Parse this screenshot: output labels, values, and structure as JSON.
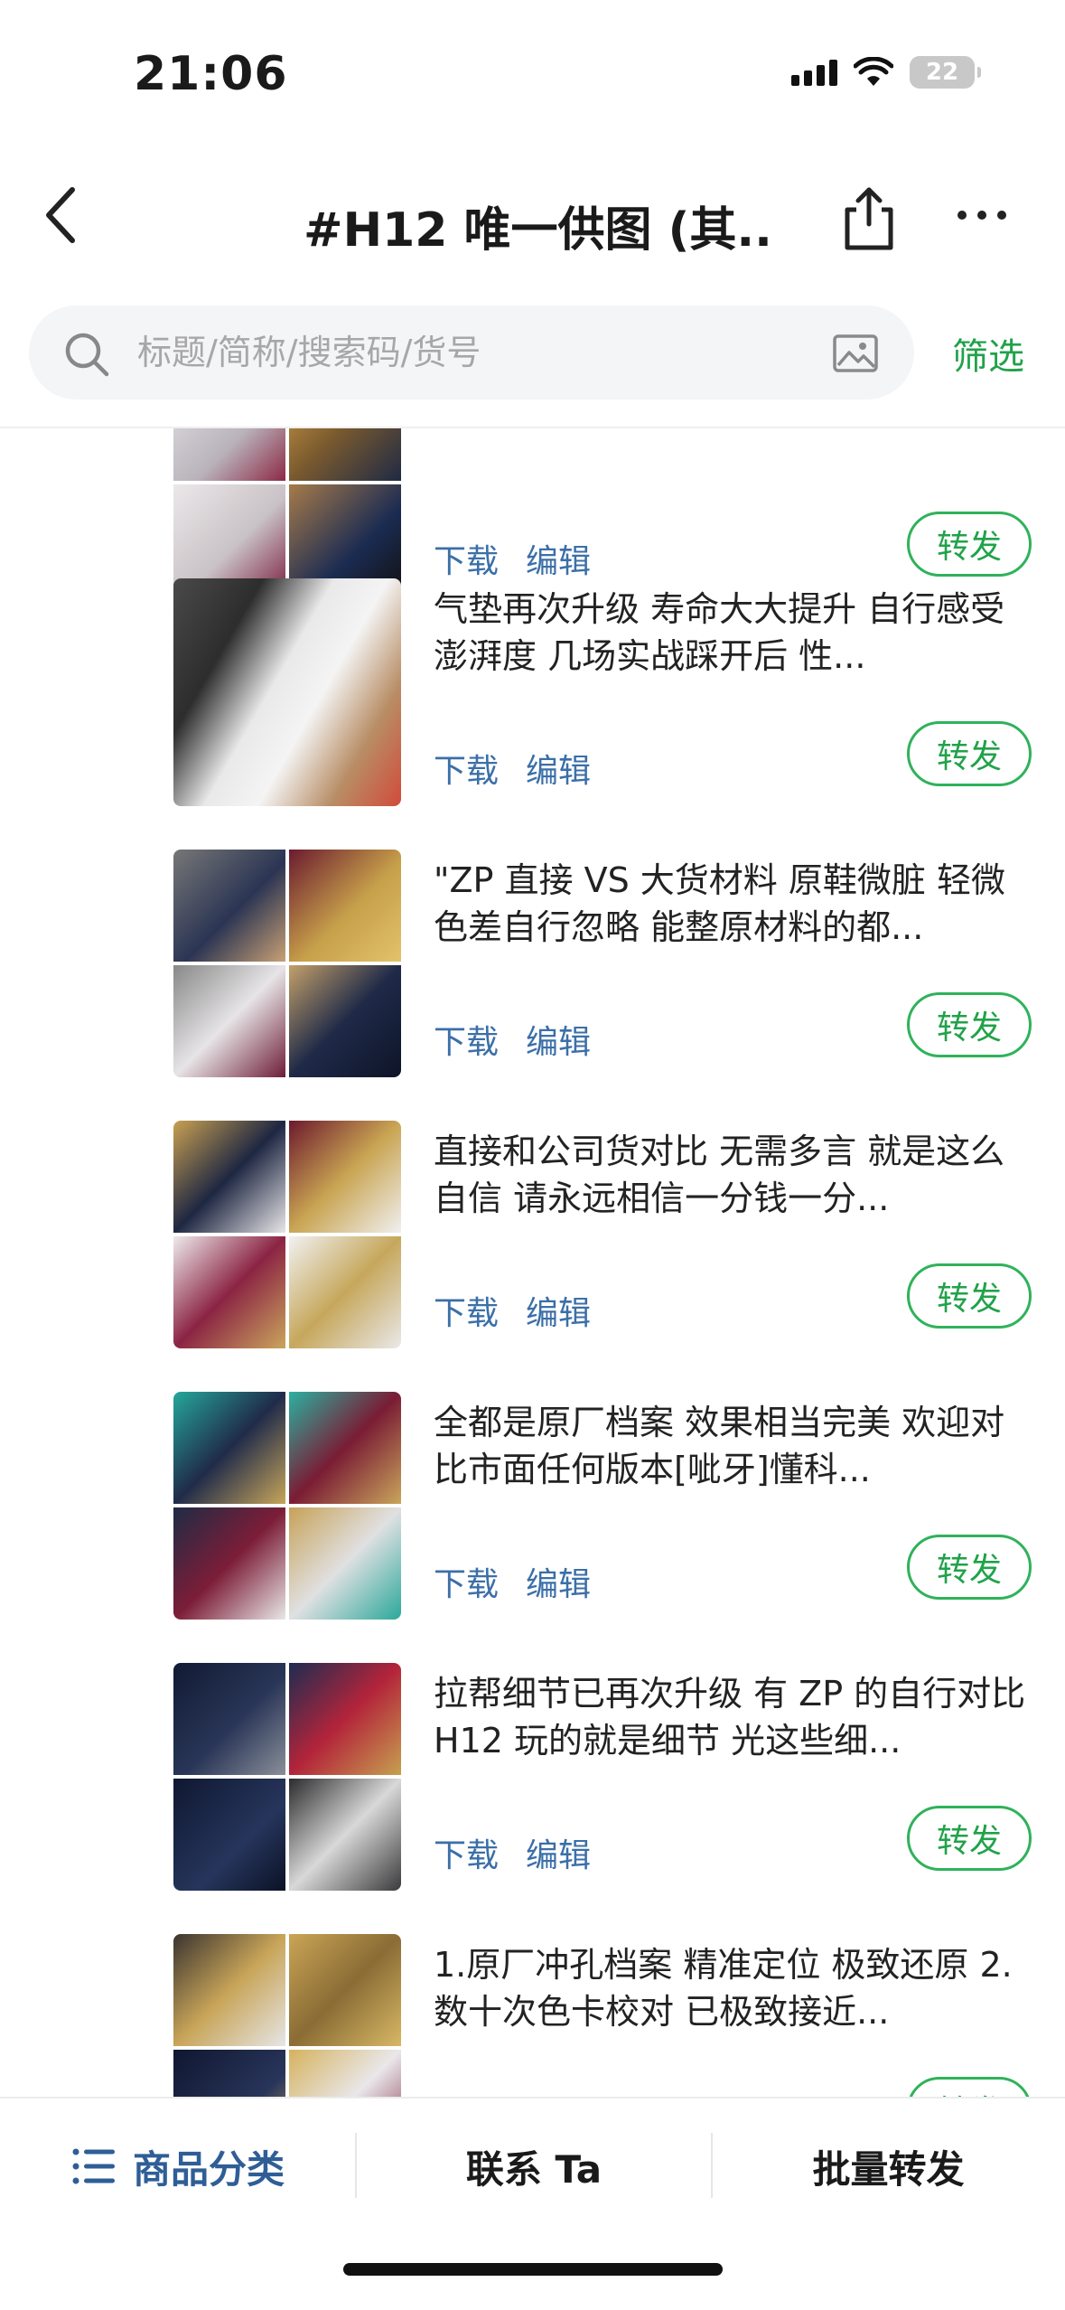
{
  "status_bar": {
    "time": "21:06",
    "battery": "22"
  },
  "nav": {
    "title": "#H12 唯一供图 (其..."
  },
  "search": {
    "placeholder": "标题/简称/搜索码/货号",
    "filter_label": "筛选"
  },
  "colors": {
    "accent_green": "#21a24a",
    "link_blue": "#3b6fa8",
    "tab_blue": "#2f5e96"
  },
  "actions": {
    "download": "下载",
    "edit": "编辑",
    "forward": "转发"
  },
  "items": [
    {
      "desc": ""
    },
    {
      "desc": "气垫再次升级 寿命大大提升 自行感受澎湃度 几场实战踩开后 性..."
    },
    {
      "desc": "\"ZP 直接 VS 大货材料 原鞋微脏 轻微色差自行忽略 能整原材料的都..."
    },
    {
      "desc": "直接和公司货对比 无需多言 就是这么自信 请永远相信一分钱一分..."
    },
    {
      "desc": "全都是原厂档案 效果相当完美 欢迎对比市面任何版本[呲牙]懂科..."
    },
    {
      "desc": "拉帮细节已再次升级 有 ZP 的自行对比 H12 玩的就是细节 光这些细..."
    },
    {
      "desc": "1.原厂冲孔档案 精准定位 极致还原 2.数十次色卡校对 已极致接近..."
    }
  ],
  "bottom_tabs": {
    "category": "商品分类",
    "contact": "联系 Ta",
    "batch_forward": "批量转发"
  }
}
